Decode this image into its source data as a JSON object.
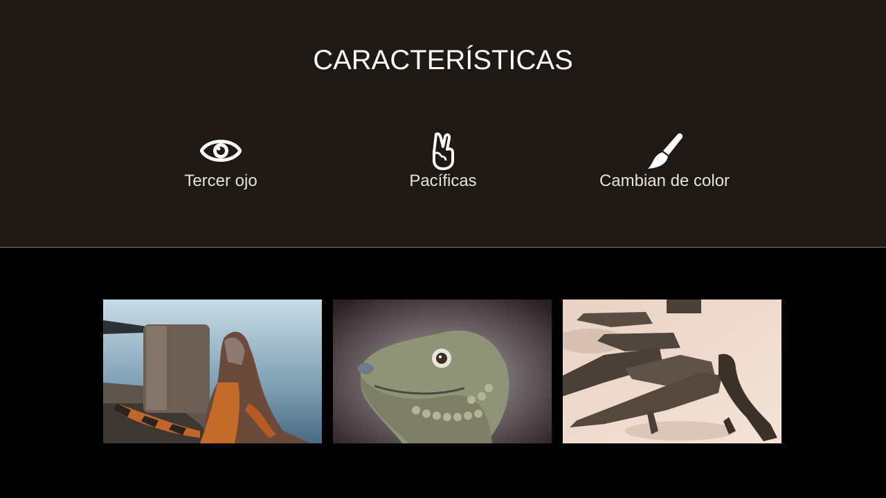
{
  "features": {
    "title": "CARACTERÍSTICAS",
    "items": [
      {
        "label": "Tercer ojo",
        "icon": "eye-icon"
      },
      {
        "label": "Pacíficas",
        "icon": "peace-hand-icon"
      },
      {
        "label": "Cambian de color",
        "icon": "paintbrush-icon"
      }
    ]
  },
  "gallery": {
    "images": [
      {
        "subject": "iguana-on-rocks-by-water"
      },
      {
        "subject": "iguana-head-closeup"
      },
      {
        "subject": "iguanas-on-sand"
      }
    ]
  },
  "colors": {
    "features_bg": "#1e1915",
    "gallery_bg": "#000000",
    "text": "#ffffff",
    "divider": "#8a6f6a"
  }
}
